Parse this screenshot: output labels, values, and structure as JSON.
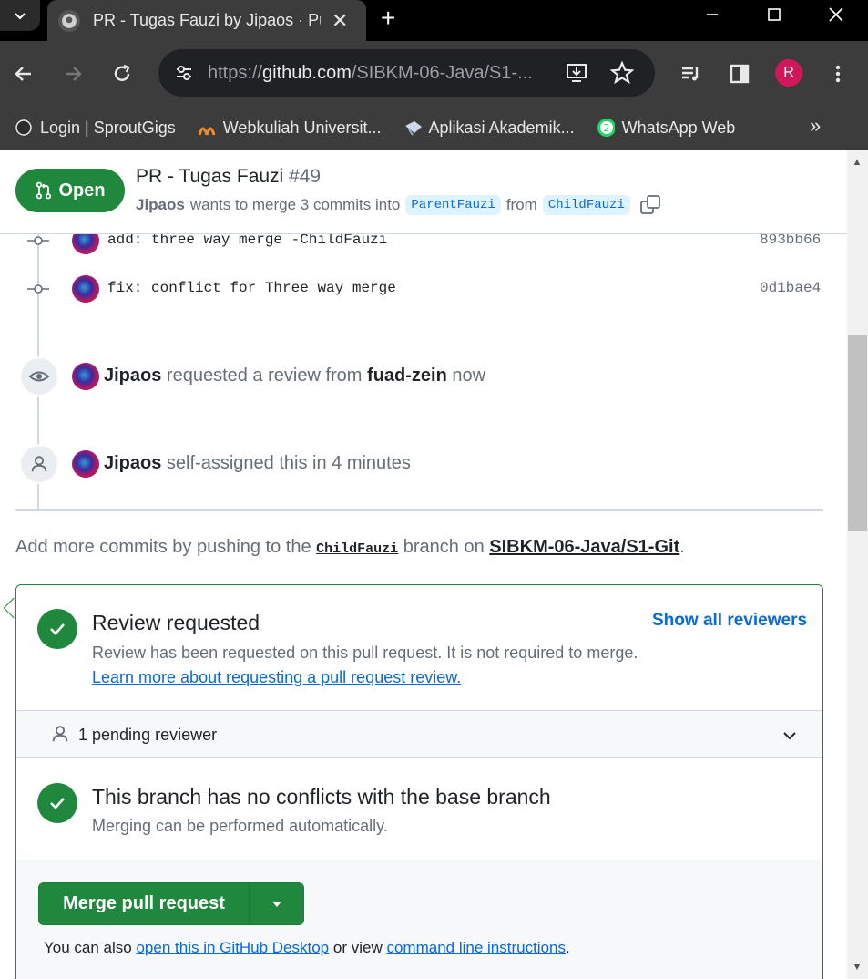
{
  "browser": {
    "tab_title": "PR - Tugas Fauzi by Jipaos · Pull",
    "url_prefix": "https://",
    "url_host": "github.com",
    "url_path": "/SIBKM-06-Java/S1-...",
    "profile_initial": "R",
    "bookmarks": [
      {
        "label": "Login | SproutGigs",
        "icon": "sproutgigs-icon"
      },
      {
        "label": "Webkuliah Universit...",
        "icon": "webkuliah-icon"
      },
      {
        "label": "Aplikasi Akademik...",
        "icon": "akademik-icon"
      },
      {
        "label": "WhatsApp Web",
        "icon": "whatsapp-icon"
      }
    ],
    "bookmarks_more": "»"
  },
  "pr": {
    "state_label": "Open",
    "title": "PR - Tugas Fauzi",
    "number": "#49",
    "author": "Jipaos",
    "merge_text": "wants to merge 3 commits into",
    "base_branch": "ParentFauzi",
    "from_text": "from",
    "head_branch": "ChildFauzi"
  },
  "commits": [
    {
      "message": "add: three way merge -ChildFauzi",
      "sha": "893bb66"
    },
    {
      "message": "fix: conflict for Three way merge",
      "sha": "0d1bae4"
    }
  ],
  "events": [
    {
      "actor": "Jipaos",
      "text": "requested a review from",
      "target": "fuad-zein",
      "time": "now",
      "icon": "eye-icon"
    },
    {
      "actor": "Jipaos",
      "text": "self-assigned this",
      "target": "",
      "time": "in 4 minutes",
      "icon": "person-icon"
    }
  ],
  "hint": {
    "prefix": "Add more commits by pushing to the",
    "branch": "ChildFauzi",
    "middle": "branch on",
    "repo": "SIBKM-06-Java/S1-Git",
    "suffix": "."
  },
  "merge_box": {
    "review_title": "Review requested",
    "review_desc": "Review has been requested on this pull request. It is not required to merge.",
    "review_link": "Learn more about requesting a pull request review.",
    "show_all": "Show all reviewers",
    "pending": "1 pending reviewer",
    "conflict_title": "This branch has no conflicts with the base branch",
    "conflict_desc": "Merging can be performed automatically.",
    "merge_button": "Merge pull request",
    "also_prefix": "You can also",
    "also_link1": "open this in GitHub Desktop",
    "also_middle": "or view",
    "also_link2": "command line instructions",
    "also_suffix": "."
  },
  "colors": {
    "open_green": "#1f883d",
    "link_blue": "#0969da",
    "branch_chip_bg": "#ddf4ff",
    "muted_text": "#656d76"
  }
}
